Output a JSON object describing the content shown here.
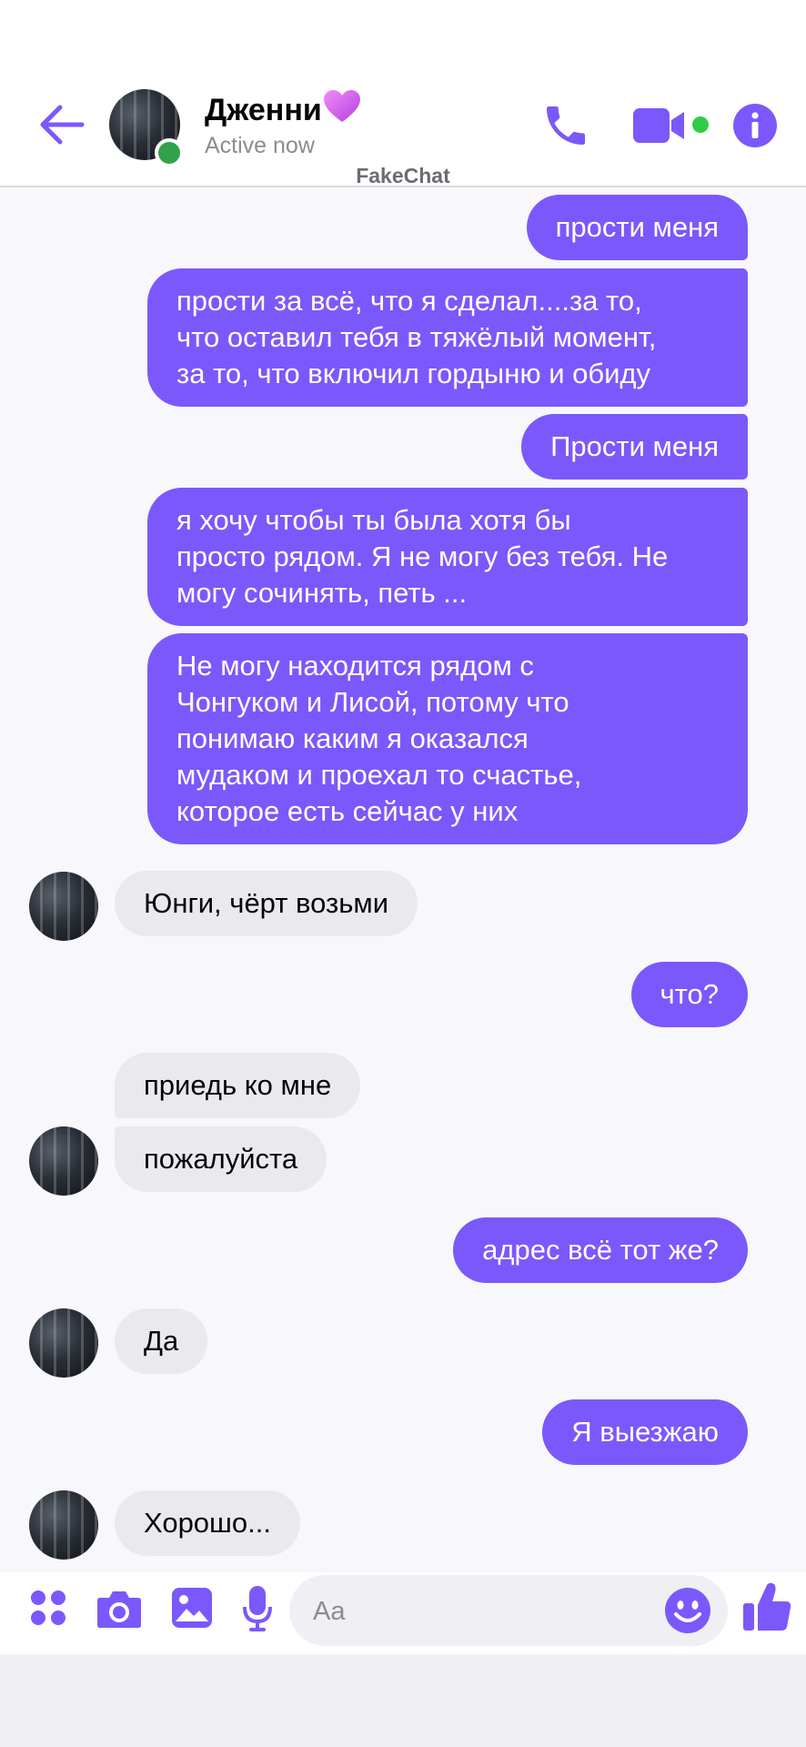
{
  "header": {
    "contact_name": "Дженни",
    "status": "Active now",
    "watermark": "FakeChat"
  },
  "messages": [
    {
      "side": "out",
      "text": "прости меня"
    },
    {
      "side": "out",
      "text": "прости за всё, что я сделал....за то,\nчто оставил тебя в тяжёлый момент,\nза то, что включил гордыню и обиду"
    },
    {
      "side": "out",
      "text": "Прости меня"
    },
    {
      "side": "out",
      "text": "я хочу чтобы ты была хотя бы\nпросто рядом. Я не могу без тебя. Не\nмогу сочинять,  петь ..."
    },
    {
      "side": "out",
      "text": "Не могу находится рядом с\nЧонгуком и Лисой, потому что\nпонимаю каким я оказался\nмудаком и проехал то счастье,\nкоторое есть сейчас у них"
    },
    {
      "side": "in",
      "text": "Юнги, чёрт возьми"
    },
    {
      "side": "out",
      "text": "что?"
    },
    {
      "side": "in",
      "text": "приедь ко мне"
    },
    {
      "side": "in",
      "text": "пожалуйста"
    },
    {
      "side": "out",
      "text": "адрес всё тот же?"
    },
    {
      "side": "in",
      "text": "Да"
    },
    {
      "side": "out",
      "text": "Я выезжаю"
    },
    {
      "side": "in",
      "text": "Хорошо..."
    }
  ],
  "composer": {
    "placeholder": "Aa"
  },
  "colors": {
    "accent": "#7b58fb",
    "outgoing_bubble": "#7b58fb",
    "incoming_bubble": "#eae9ee",
    "online": "#31a24c"
  },
  "icons": [
    "back-arrow-icon",
    "phone-icon",
    "video-camera-icon",
    "info-icon",
    "apps-icon",
    "camera-icon",
    "gallery-icon",
    "microphone-icon",
    "emoji-icon",
    "thumbs-up-icon",
    "purple-heart-emoji"
  ]
}
